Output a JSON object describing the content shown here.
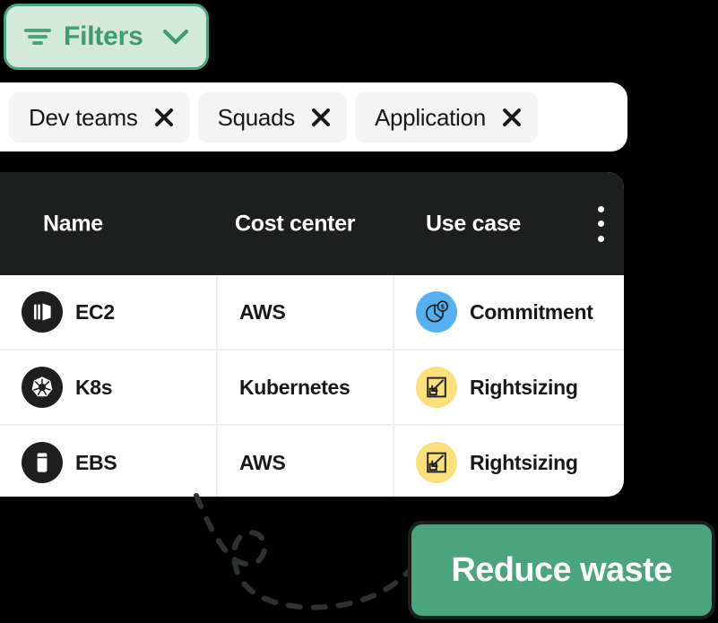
{
  "colors": {
    "accent_green": "#4aa57e",
    "filters_fill": "#d3e9dc",
    "filters_text": "#3f9b73",
    "table_header_bg": "#1d1f1e",
    "chip_bg": "#f4f4f5",
    "commitment_badge": "#54b0f0",
    "rightsizing_badge": "#fbdf7a",
    "row_text": "#18181b"
  },
  "filters_button": {
    "label": "Filters",
    "icon": "filter-icon",
    "chevron": "chevron-down-icon"
  },
  "filter_chips": [
    {
      "label": "Dev teams",
      "remove_icon": "close-icon"
    },
    {
      "label": "Squads",
      "remove_icon": "close-icon"
    },
    {
      "label": "Application",
      "remove_icon": "close-icon"
    }
  ],
  "table": {
    "columns": [
      "Name",
      "Cost center",
      "Use case"
    ],
    "menu_icon": "kebab-menu-icon",
    "rows": [
      {
        "name": "EC2",
        "name_icon": "ec2-icon",
        "cost_center": "AWS",
        "use_case": "Commitment",
        "use_case_icon": "commitment-clock-dollar-icon",
        "use_case_color": "#54b0f0"
      },
      {
        "name": "K8s",
        "name_icon": "kubernetes-icon",
        "cost_center": "Kubernetes",
        "use_case": "Rightsizing",
        "use_case_icon": "rightsizing-resize-icon",
        "use_case_color": "#fbdf7a"
      },
      {
        "name": "EBS",
        "name_icon": "ebs-storage-icon",
        "cost_center": "AWS",
        "use_case": "Rightsizing",
        "use_case_icon": "rightsizing-resize-icon",
        "use_case_color": "#fbdf7a"
      }
    ]
  },
  "callout": {
    "arrow_icon": "dashed-curved-arrow",
    "button_label": "Reduce waste"
  }
}
